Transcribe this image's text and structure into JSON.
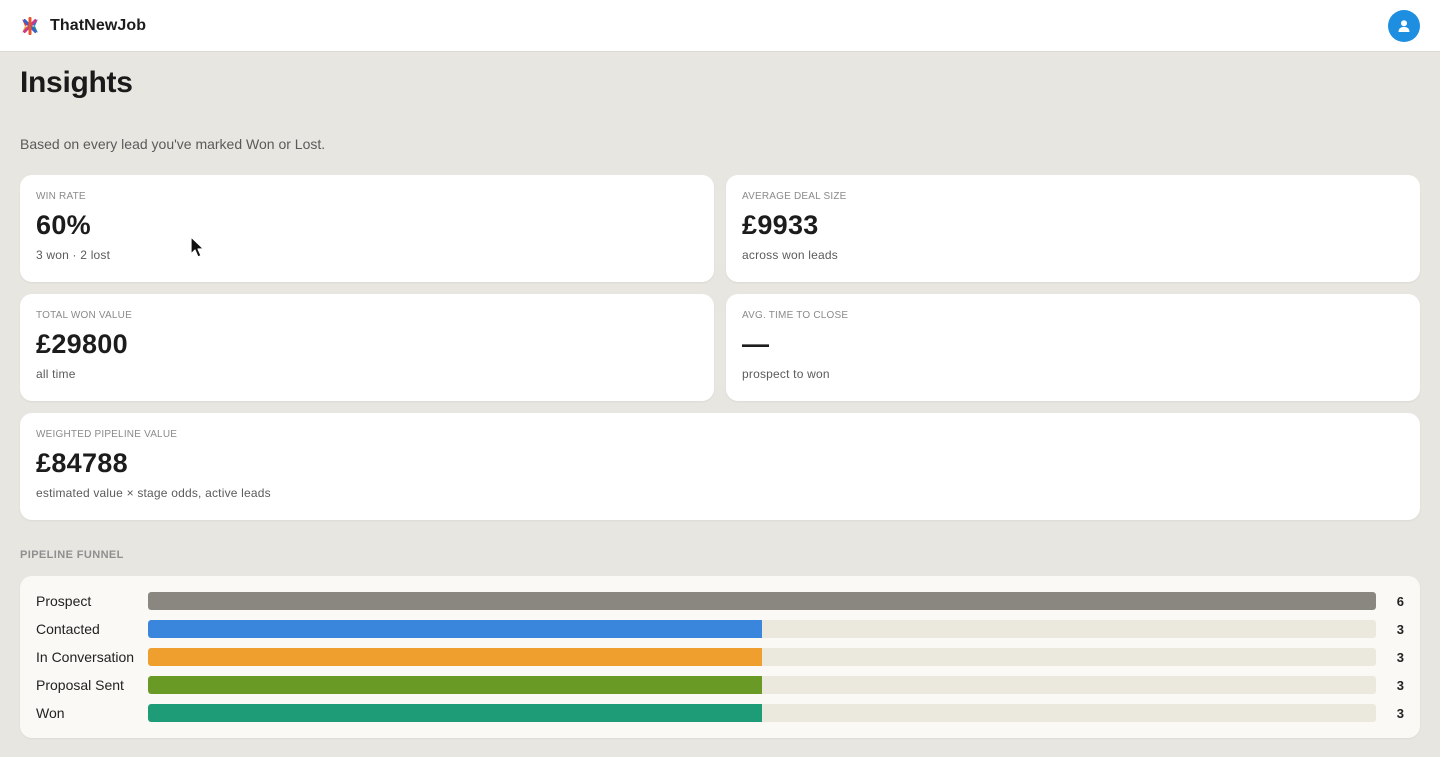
{
  "app": {
    "name": "ThatNewJob",
    "logo_icon": "asterisk-logo-icon",
    "avatar_icon": "user-icon",
    "accent_color": "#1e8fe0"
  },
  "page": {
    "title": "Insights",
    "subtitle": "Based on every lead you've marked Won or Lost."
  },
  "stats": {
    "win_rate": {
      "label": "WIN RATE",
      "value": "60%",
      "sub": "3 won · 2 lost"
    },
    "avg_deal": {
      "label": "AVERAGE DEAL SIZE",
      "value": "£9933",
      "sub": "across won leads"
    },
    "total_won": {
      "label": "TOTAL WON VALUE",
      "value": "£29800",
      "sub": "all time"
    },
    "avg_time": {
      "label": "AVG. TIME TO CLOSE",
      "value": "—",
      "sub": "prospect to won"
    },
    "weighted": {
      "label": "WEIGHTED PIPELINE VALUE",
      "value": "£84788",
      "sub": "estimated value × stage odds, active leads"
    }
  },
  "funnel": {
    "title": "PIPELINE FUNNEL",
    "max": 6,
    "stages": [
      {
        "label": "Prospect",
        "count": "6",
        "value": 6,
        "color": "#8a8781"
      },
      {
        "label": "Contacted",
        "count": "3",
        "value": 3,
        "color": "#3a86dc"
      },
      {
        "label": "In Conversation",
        "count": "3",
        "value": 3,
        "color": "#ef9f2e"
      },
      {
        "label": "Proposal Sent",
        "count": "3",
        "value": 3,
        "color": "#6a9a26"
      },
      {
        "label": "Won",
        "count": "3",
        "value": 3,
        "color": "#1e9b77"
      }
    ]
  }
}
